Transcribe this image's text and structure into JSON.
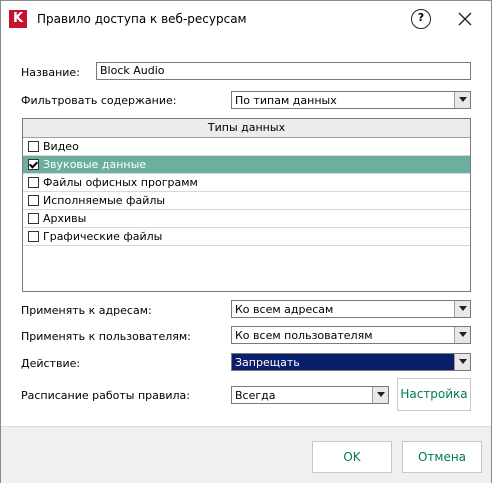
{
  "window": {
    "title": "Правило доступа к веб-ресурсам",
    "app_icon": "kaspersky-logo"
  },
  "name_field": {
    "label": "Название:",
    "value": "Block Audio"
  },
  "filter": {
    "label": "Фильтровать содержание:",
    "value": "По типам данных"
  },
  "data_types": {
    "header": "Типы данных",
    "items": [
      {
        "label": "Видео",
        "checked": false,
        "selected": false
      },
      {
        "label": "Звуковые данные",
        "checked": true,
        "selected": true
      },
      {
        "label": "Файлы офисных программ",
        "checked": false,
        "selected": false
      },
      {
        "label": "Исполняемые файлы",
        "checked": false,
        "selected": false
      },
      {
        "label": "Архивы",
        "checked": false,
        "selected": false
      },
      {
        "label": "Графические файлы",
        "checked": false,
        "selected": false
      }
    ]
  },
  "apply_addresses": {
    "label": "Применять к адресам:",
    "value": "Ко всем адресам"
  },
  "apply_users": {
    "label": "Применять к пользователям:",
    "value": "Ко всем пользователям"
  },
  "action": {
    "label": "Действие:",
    "value": "Запрещать"
  },
  "schedule": {
    "label": "Расписание работы правила:",
    "value": "Всегда",
    "settings_button": "Настройка"
  },
  "footer": {
    "ok": "OK",
    "cancel": "Отмена"
  },
  "colors": {
    "accent": "#007a5a",
    "selected_row": "#6aafa0",
    "highlight": "#0a1f6b",
    "brand": "#c8102e"
  }
}
